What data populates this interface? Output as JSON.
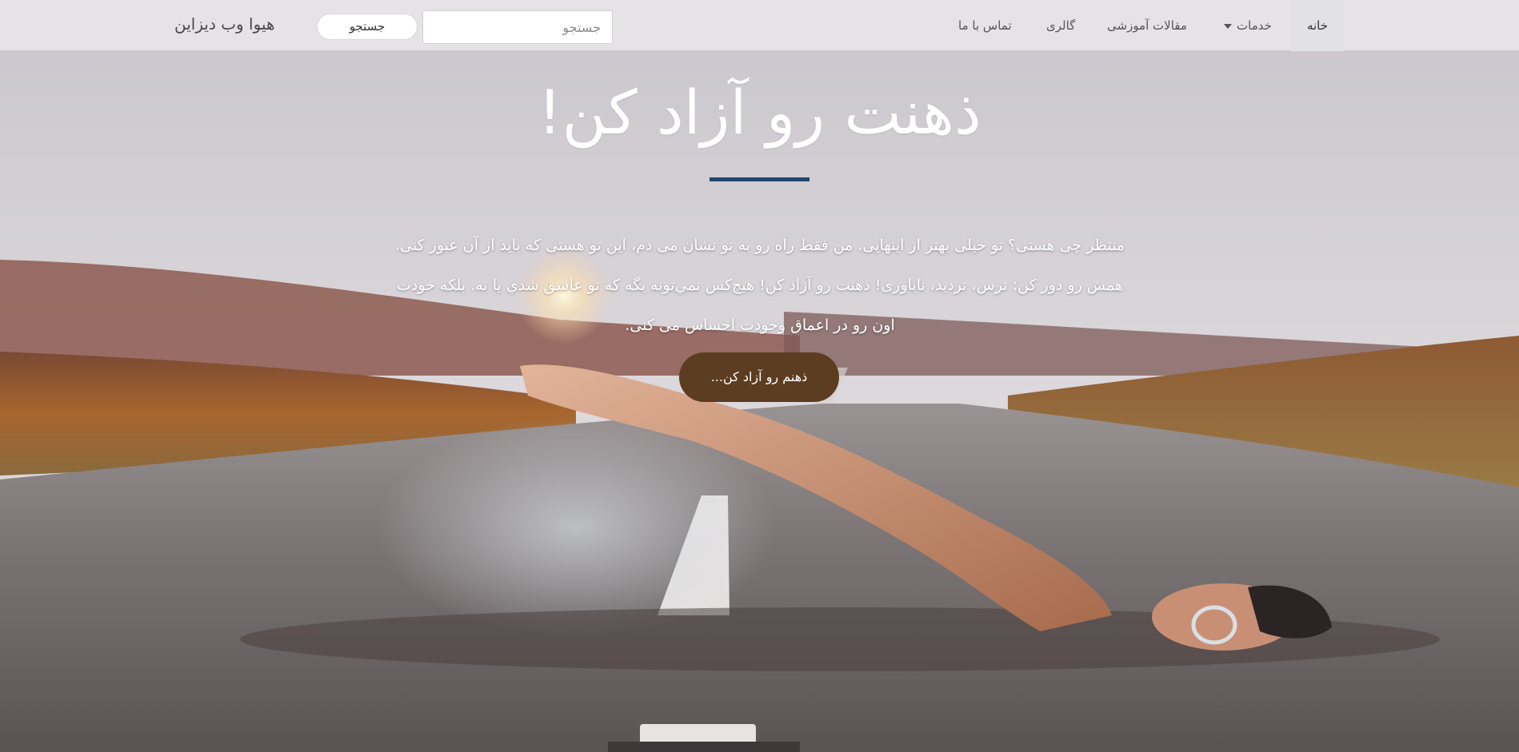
{
  "navbar": {
    "brand": "هیوا وب دیزاین",
    "search_button_label": "جستجو",
    "search_placeholder": "جستجو",
    "items": [
      {
        "label": "خانه",
        "active": true
      },
      {
        "label": "خدمات",
        "has_dropdown": true
      },
      {
        "label": "مقالات آموزشی"
      },
      {
        "label": "گالری"
      },
      {
        "label": "تماس با ما"
      }
    ]
  },
  "hero": {
    "title": "ذهنت رو آزاد کن!",
    "paragraph_lines": [
      "منتظر چی هستی؟ تو خیلی بهتر از اینهایی. من فقط راه رو به تو نشان می دم، این تو هستی که باید از آن عبور کنی.",
      "همش رو دور کن: ترس، تردید، ناباوری! ذهنت رو آزاد کن! هيچ‌کس نمي‌تونه بگه که تو عاشق شدي يا نه. بلکه خودت",
      "اون رو در اعماق وجودت احساس می کنی."
    ],
    "cta_label": "ذهنم رو آزاد کن...",
    "divider_color": "#22466d",
    "cta_color": "#5c3d21"
  },
  "background": {
    "description_icon": "swimmer-on-road-photo"
  }
}
